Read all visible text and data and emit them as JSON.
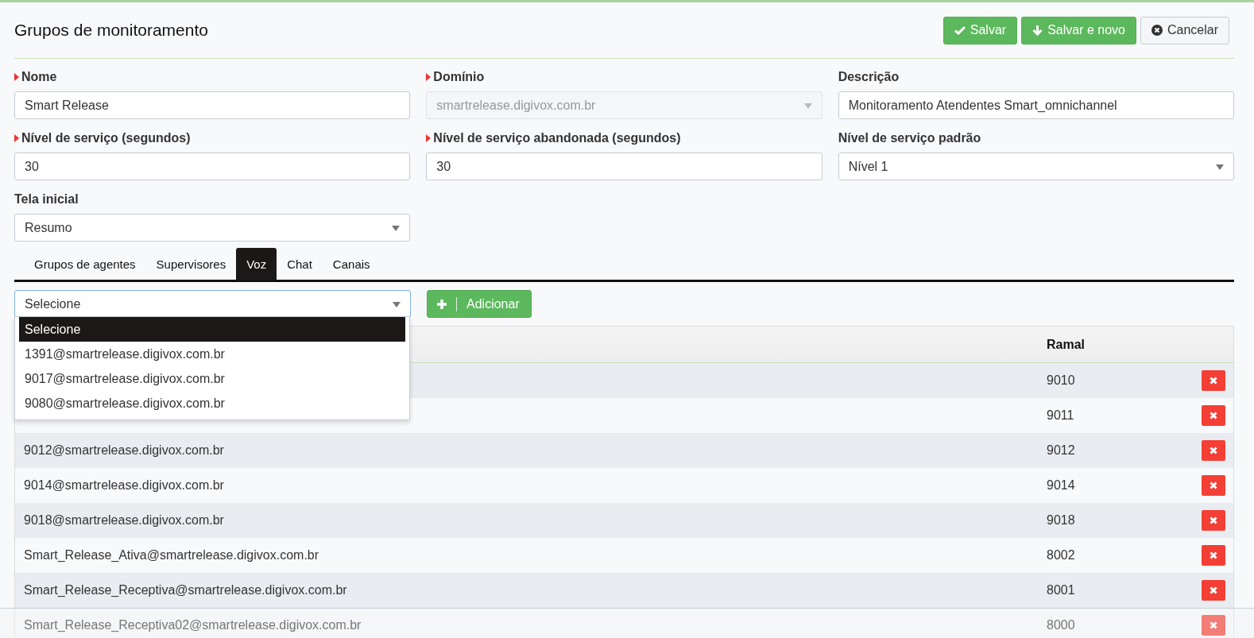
{
  "title": "Grupos de monitoramento",
  "actions": [
    {
      "label": "Salvar",
      "kind": "save"
    },
    {
      "label": "Salvar e novo",
      "kind": "save-new"
    },
    {
      "label": "Cancelar",
      "kind": "cancel"
    }
  ],
  "fields": [
    {
      "label": "Nome",
      "required": true,
      "kind": "text",
      "value": "Smart Release",
      "disabled": false
    },
    {
      "label": "Domínio",
      "required": true,
      "kind": "select",
      "value": "smartrelease.digivox.com.br",
      "disabled": true
    },
    {
      "label": "Descrição",
      "required": false,
      "kind": "text",
      "value": "Monitoramento Atendentes Smart_omnichannel",
      "disabled": false
    },
    {
      "label": "Nível de serviço (segundos)",
      "required": true,
      "kind": "text",
      "value": "30",
      "disabled": false
    },
    {
      "label": "Nível de serviço abandonada (segundos)",
      "required": true,
      "kind": "text",
      "value": "30",
      "disabled": false
    },
    {
      "label": "Nível de serviço padrão",
      "required": false,
      "kind": "select",
      "value": "Nível 1",
      "disabled": false
    },
    {
      "label": "Tela inicial",
      "required": false,
      "kind": "select",
      "value": "Resumo",
      "disabled": false
    }
  ],
  "tabs": [
    {
      "label": "Grupos de agentes",
      "selected": false
    },
    {
      "label": "Supervisores",
      "selected": false
    },
    {
      "label": "Voz",
      "selected": true
    },
    {
      "label": "Chat",
      "selected": false
    },
    {
      "label": "Canais",
      "selected": false
    }
  ],
  "voice": {
    "select": {
      "value": "Selecione",
      "expanded": true,
      "options": [
        {
          "label": "Selecione",
          "selected": true
        },
        {
          "label": "1391@smartrelease.digivox.com.br",
          "selected": false
        },
        {
          "label": "9017@smartrelease.digivox.com.br",
          "selected": false
        },
        {
          "label": "9080@smartrelease.digivox.com.br",
          "selected": false
        }
      ]
    },
    "add_button": "Adicionar",
    "table": {
      "column_2": "Ramal",
      "rows": [
        {
          "extension": "9010"
        },
        {
          "extension": "9011"
        },
        {
          "address": "9012@smartrelease.digivox.com.br",
          "extension": "9012"
        },
        {
          "address": "9014@smartrelease.digivox.com.br",
          "extension": "9014"
        },
        {
          "address": "9018@smartrelease.digivox.com.br",
          "extension": "9018"
        },
        {
          "address": "Smart_Release_Ativa@smartrelease.digivox.com.br",
          "extension": "8002"
        },
        {
          "address": "Smart_Release_Receptiva@smartrelease.digivox.com.br",
          "extension": "8001"
        },
        {
          "address": "Smart_Release_Receptiva02@smartrelease.digivox.com.br",
          "extension": "8000"
        }
      ]
    }
  }
}
